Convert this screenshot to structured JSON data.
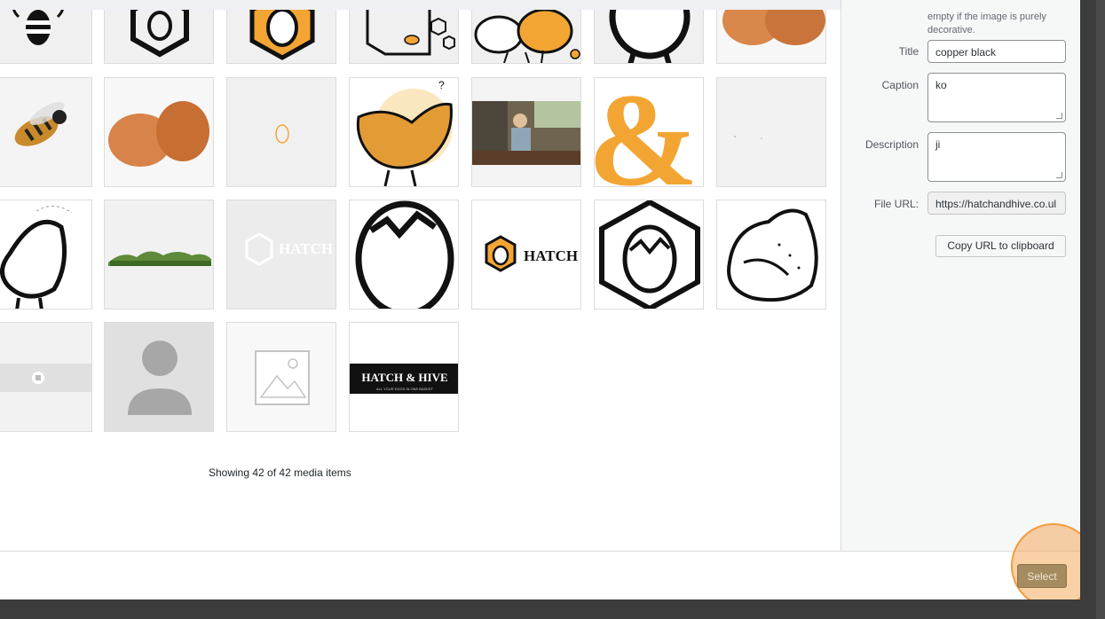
{
  "accent_color": "#f3a534",
  "media_grid": {
    "showing_text": "Showing 42 of 42 media items",
    "tiles": [
      {
        "icon": "bee-icon"
      },
      {
        "icon": "hexagon-logo-icon"
      },
      {
        "icon": "hexagon-egg-logo-icon"
      },
      {
        "icon": "bee-hexagon-icon"
      },
      {
        "icon": "chickens-icon"
      },
      {
        "icon": "egg-legs-icon"
      },
      {
        "icon": "eggs-photo-icon"
      },
      {
        "icon": "bee-photo-icon"
      },
      {
        "icon": "eggs-photo-icon"
      },
      {
        "icon": "egg-outline-icon"
      },
      {
        "icon": "orange-chicken-icon"
      },
      {
        "icon": "farm-photo-icon"
      },
      {
        "icon": "ampersand-icon"
      },
      {
        "icon": "blank-icon"
      },
      {
        "icon": "chicken-outline-icon"
      },
      {
        "icon": "grass-icon"
      },
      {
        "icon": "hatch-hive-white-logo-icon",
        "text": "HATCH &HIVE"
      },
      {
        "icon": "cracked-egg-icon"
      },
      {
        "icon": "hatch-hive-logo-icon",
        "text": "HATCH &HIVE"
      },
      {
        "icon": "hexagon-cracked-egg-icon"
      },
      {
        "icon": "chicken-sketch-icon"
      },
      {
        "icon": "banner-icon"
      },
      {
        "icon": "avatar-placeholder-icon"
      },
      {
        "icon": "image-placeholder-icon"
      },
      {
        "icon": "hatch-hive-banner-icon",
        "text": "HATCH & HIVE",
        "subtext": "ALL YOUR EGGS IN ONE BASKET"
      }
    ]
  },
  "details": {
    "alt_note": "empty if the image is purely decorative.",
    "title_label": "Title",
    "title_value": "copper black",
    "caption_label": "Caption",
    "caption_value": "ko",
    "description_label": "Description",
    "description_value": "ji",
    "file_url_label": "File URL:",
    "file_url_value": "https://hatchandhive.co.ul",
    "copy_url_label": "Copy URL to clipboard"
  },
  "footer": {
    "select_label": "Select"
  }
}
